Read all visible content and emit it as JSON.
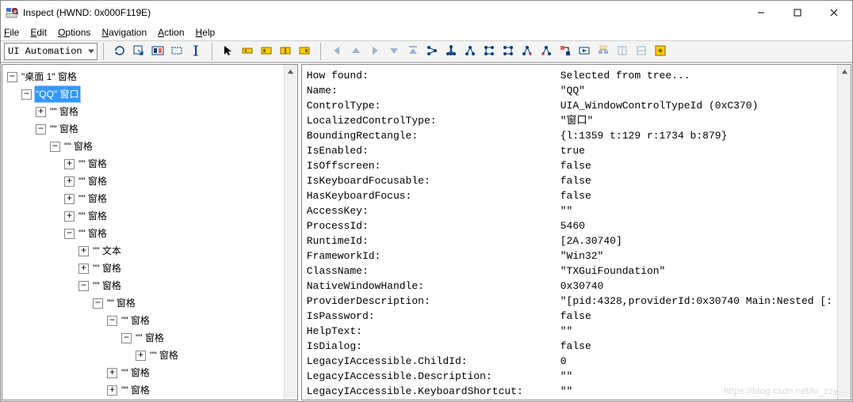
{
  "titlebar": {
    "title": "Inspect  (HWND: 0x000F119E)"
  },
  "winbuttons": {
    "minimize": "minimize",
    "maximize": "maximize",
    "close": "close"
  },
  "menu": {
    "file": {
      "label": "File",
      "hotkey_index": 0
    },
    "edit": {
      "label": "Edit",
      "hotkey_index": 0
    },
    "options": {
      "label": "Options",
      "hotkey_index": 0
    },
    "navigation": {
      "label": "Navigation",
      "hotkey_index": 0
    },
    "action": {
      "label": "Action",
      "hotkey_index": 0
    },
    "help": {
      "label": "Help",
      "hotkey_index": 0
    }
  },
  "toolbar": {
    "mode": "UI Automation",
    "buttons_left": [
      "refresh",
      "watch-cursor",
      "watch-focus",
      "show-rect",
      "show-caret"
    ],
    "buttons_mid": [
      "pointer",
      "prev-sibling",
      "parent-rect",
      "caret-rect",
      "focus-rect"
    ],
    "buttons_right": [
      "arrow-left",
      "arrow-up",
      "arrow-right",
      "arrow-down",
      "arrow-bar-up",
      "tree-highlight",
      "child-first",
      "parent",
      "next-sibling",
      "prev-sibling-2",
      "last-child",
      "first-sibling",
      "msaa-bridge",
      "action-default",
      "copy-tree",
      "paste",
      "clear",
      "show-highlight"
    ]
  },
  "tree": [
    {
      "indent": 0,
      "open": true,
      "text": "\"桌面 1\" 窗格"
    },
    {
      "indent": 1,
      "open": true,
      "text": "\"QQ\" 窗口",
      "selected": true
    },
    {
      "indent": 2,
      "open": false,
      "text": "\"\" 窗格"
    },
    {
      "indent": 2,
      "open": true,
      "text": "\"\" 窗格"
    },
    {
      "indent": 3,
      "open": true,
      "text": "\"\" 窗格"
    },
    {
      "indent": 4,
      "open": false,
      "text": "\"\" 窗格"
    },
    {
      "indent": 4,
      "open": false,
      "text": "\"\" 窗格"
    },
    {
      "indent": 4,
      "open": false,
      "text": "\"\" 窗格"
    },
    {
      "indent": 4,
      "open": false,
      "text": "\"\" 窗格"
    },
    {
      "indent": 4,
      "open": true,
      "text": "\"\" 窗格"
    },
    {
      "indent": 5,
      "open": false,
      "text": "\"\" 文本"
    },
    {
      "indent": 5,
      "open": false,
      "text": "\"\" 窗格"
    },
    {
      "indent": 5,
      "open": true,
      "text": "\"\" 窗格"
    },
    {
      "indent": 6,
      "open": true,
      "text": "\"\" 窗格"
    },
    {
      "indent": 7,
      "open": true,
      "text": "\"\" 窗格"
    },
    {
      "indent": 8,
      "open": true,
      "text": "\"\" 窗格"
    },
    {
      "indent": 9,
      "open": false,
      "text": "\"\" 窗格"
    },
    {
      "indent": 7,
      "open": false,
      "text": "\"\" 窗格"
    },
    {
      "indent": 7,
      "open": false,
      "text": "\"\" 窗格"
    }
  ],
  "properties": [
    {
      "key": "How found:",
      "value": "Selected from tree..."
    },
    {
      "key": "Name:",
      "value": "\"QQ\""
    },
    {
      "key": "ControlType:",
      "value": "UIA_WindowControlTypeId (0xC370)"
    },
    {
      "key": "LocalizedControlType:",
      "value": "\"窗口\""
    },
    {
      "key": "BoundingRectangle:",
      "value": "{l:1359 t:129 r:1734 b:879}"
    },
    {
      "key": "IsEnabled:",
      "value": "true"
    },
    {
      "key": "IsOffscreen:",
      "value": "false"
    },
    {
      "key": "IsKeyboardFocusable:",
      "value": "false"
    },
    {
      "key": "HasKeyboardFocus:",
      "value": "false"
    },
    {
      "key": "AccessKey:",
      "value": "\"\""
    },
    {
      "key": "ProcessId:",
      "value": "5460"
    },
    {
      "key": "RuntimeId:",
      "value": "[2A.30740]"
    },
    {
      "key": "FrameworkId:",
      "value": "\"Win32\""
    },
    {
      "key": "ClassName:",
      "value": "\"TXGuiFoundation\""
    },
    {
      "key": "NativeWindowHandle:",
      "value": "0x30740"
    },
    {
      "key": "ProviderDescription:",
      "value": "\"[pid:4328,providerId:0x30740 Main:Nested [:"
    },
    {
      "key": "IsPassword:",
      "value": "false"
    },
    {
      "key": "HelpText:",
      "value": "\"\""
    },
    {
      "key": "IsDialog:",
      "value": "false"
    },
    {
      "key": "LegacyIAccessible.ChildId:",
      "value": "0"
    },
    {
      "key": "LegacyIAccessible.Description:",
      "value": "\"\""
    },
    {
      "key": "LegacyIAccessible.KeyboardShortcut:",
      "value": "\"\""
    }
  ],
  "watermark": "https://blog.csdn.net/lv_zzy"
}
